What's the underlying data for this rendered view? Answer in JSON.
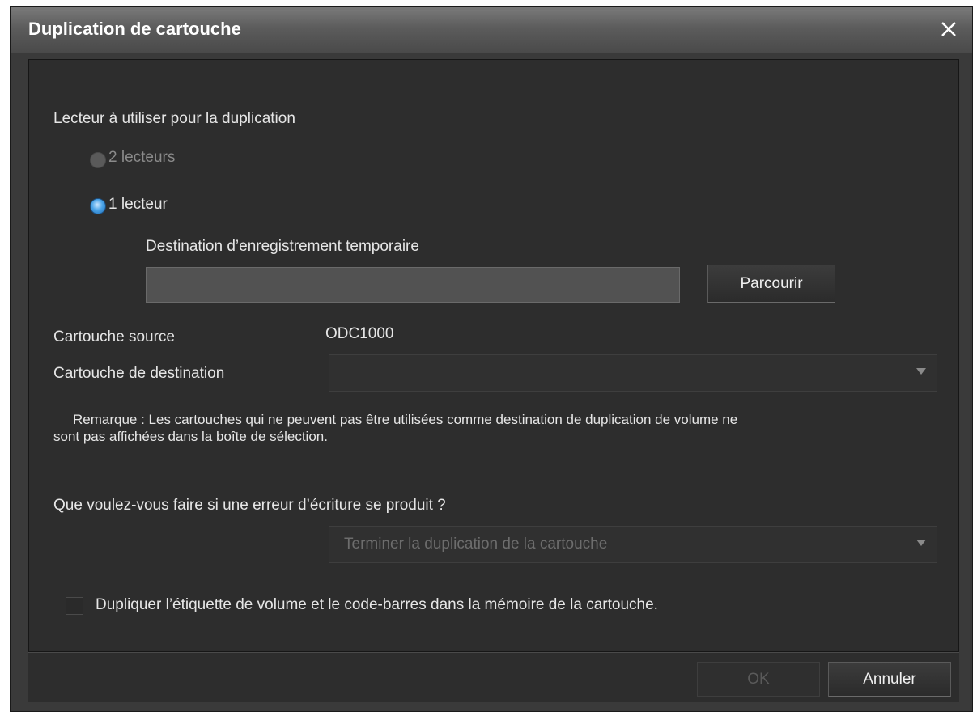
{
  "window": {
    "title": "Duplication de cartouche",
    "close_icon": "close-icon"
  },
  "drive": {
    "heading": "Lecteur à utiliser pour la duplication",
    "option_two": "2 lecteurs",
    "option_one": "1 lecteur",
    "temp_label": "Destination d’enregistrement temporaire",
    "temp_value": "",
    "browse": "Parcourir"
  },
  "cartridge": {
    "source_label": "Cartouche source",
    "source_value": "ODC1000",
    "dest_label": "Cartouche de destination",
    "dest_value": "",
    "note_line1": "Remarque : Les cartouches qui ne peuvent pas être utilisées comme destination de duplication de volume ne",
    "note_line2": "sont pas affichées dans la boîte de sélection."
  },
  "error": {
    "question": "Que voulez-vous faire si une erreur d’écriture se produit ?",
    "selected": "Terminer la duplication de la cartouche"
  },
  "options": {
    "duplicate_label": "Dupliquer l’étiquette de volume et le code-barres dans la mémoire de la cartouche.",
    "duplicate_checked": false
  },
  "footer": {
    "ok": "OK",
    "cancel": "Annuler"
  },
  "colors": {
    "title_text": "#ffffff",
    "panel_bg": "#2d2d2d",
    "radio_selected": "#4aa3e8"
  }
}
